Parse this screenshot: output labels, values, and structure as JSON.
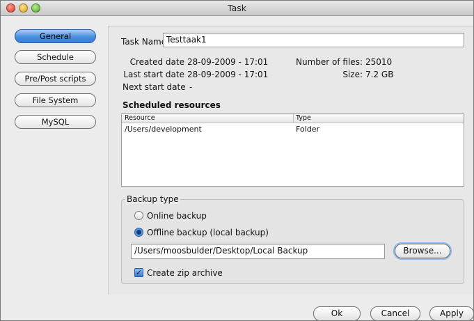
{
  "window": {
    "title": "Task"
  },
  "sidebar": {
    "items": [
      {
        "label": "General",
        "active": true
      },
      {
        "label": "Schedule",
        "active": false
      },
      {
        "label": "Pre/Post scripts",
        "active": false
      },
      {
        "label": "File System",
        "active": false
      },
      {
        "label": "MySQL",
        "active": false
      }
    ]
  },
  "general": {
    "task_name_label": "Task Name",
    "task_name_value": "Testtaak1",
    "created_label": "Created date",
    "created_value": "28-09-2009 - 17:01",
    "last_start_label": "Last start date",
    "last_start_value": "28-09-2009 - 17:01",
    "next_start_label": "Next start date",
    "next_start_value": "-",
    "num_files_label": "Number of files:",
    "num_files_value": "25010",
    "size_label": "Size:",
    "size_value": "7.2 GB"
  },
  "resources": {
    "heading": "Scheduled resources",
    "columns": [
      "Resource",
      "Type"
    ],
    "rows": [
      {
        "resource": "/Users/development",
        "type": "Folder"
      }
    ]
  },
  "backup": {
    "group_label": "Backup type",
    "online_label": "Online backup",
    "offline_label": "Offline backup (local backup)",
    "selected": "offline",
    "path_value": "/Users/moosbulder/Desktop/Local Backup",
    "browse_label": "Browse...",
    "zip_label": "Create zip archive",
    "zip_checked": true
  },
  "footer": {
    "ok_label": "Ok",
    "cancel_label": "Cancel",
    "apply_label": "Apply"
  }
}
